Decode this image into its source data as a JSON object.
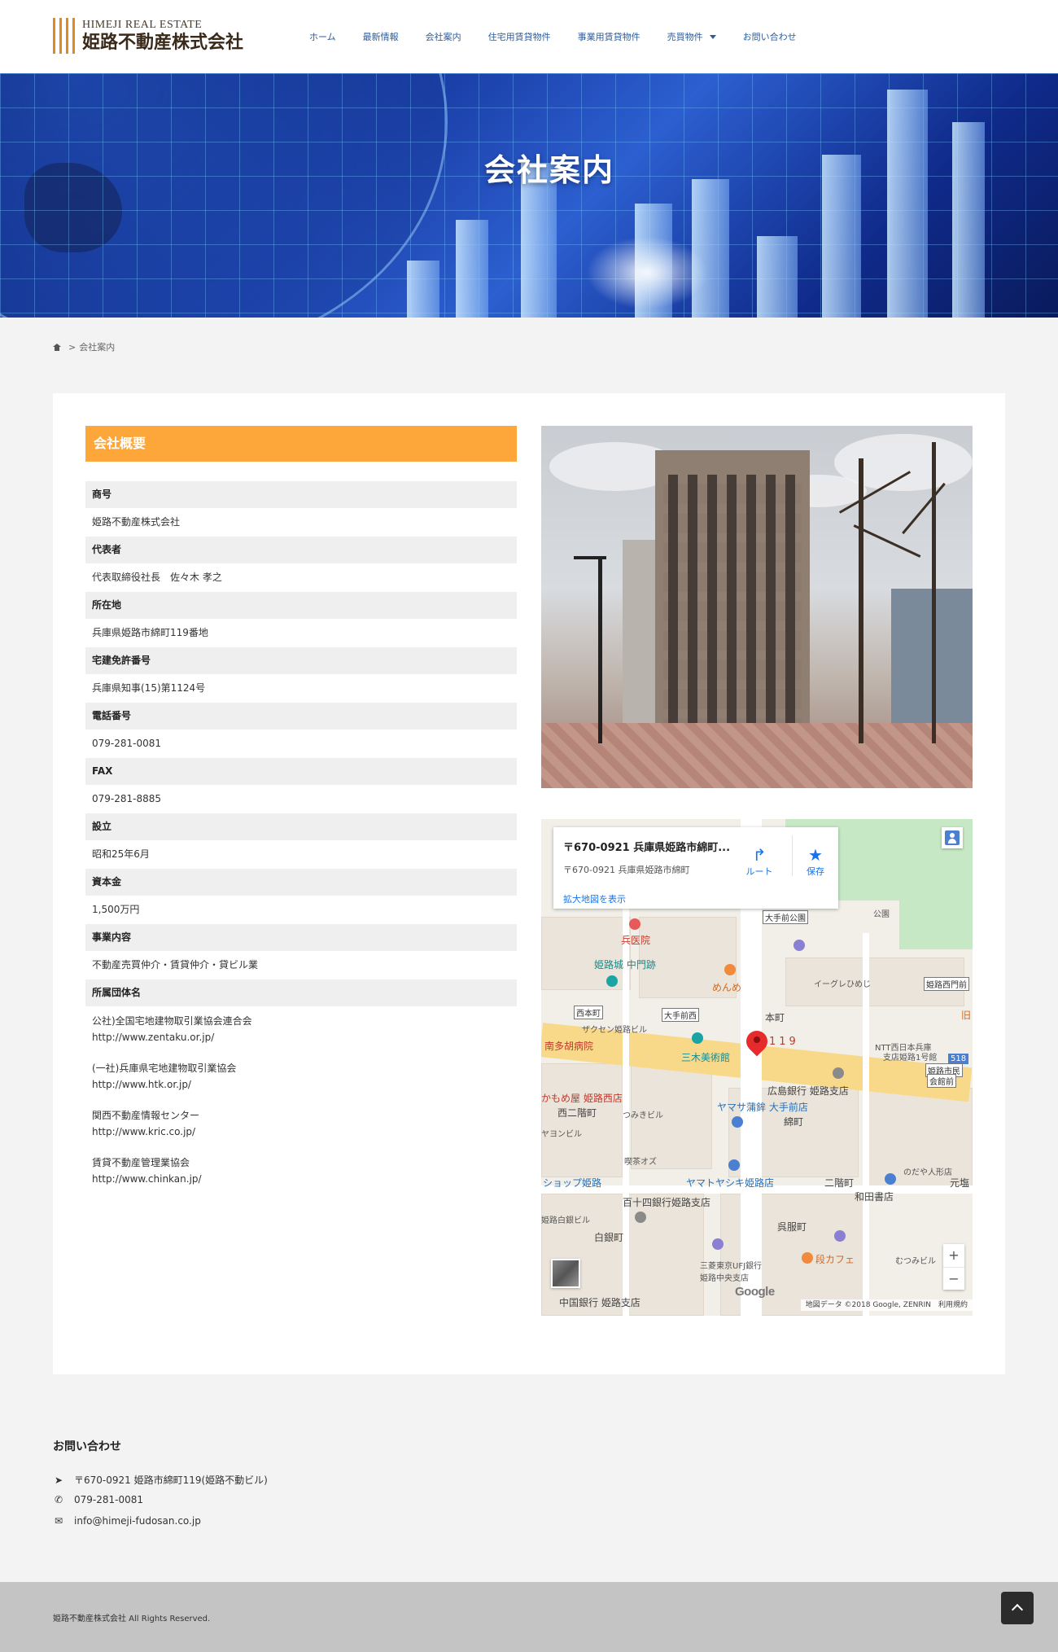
{
  "header": {
    "logo_en": "HIMEJI REAL ESTATE",
    "logo_ja": "姫路不動産株式会社",
    "nav": [
      {
        "label": "ホーム"
      },
      {
        "label": "最新情報"
      },
      {
        "label": "会社案内"
      },
      {
        "label": "住宅用賃貸物件"
      },
      {
        "label": "事業用賃貸物件"
      },
      {
        "label": "売買物件"
      },
      {
        "label": "お問い合わせ"
      }
    ]
  },
  "hero": {
    "title": "会社案内"
  },
  "breadcrumb": {
    "current": "会社案内",
    "separator": ">"
  },
  "company": {
    "heading": "会社概要",
    "rows": [
      {
        "label": "商号",
        "value": "姫路不動産株式会社"
      },
      {
        "label": "代表者",
        "value": "代表取締役社長　佐々木 孝之"
      },
      {
        "label": "所在地",
        "value": "兵庫県姫路市綿町119番地"
      },
      {
        "label": "宅建免許番号",
        "value": "兵庫県知事(15)第1124号"
      },
      {
        "label": "電話番号",
        "value": "079-281-0081"
      },
      {
        "label": "FAX",
        "value": "079-281-8885"
      },
      {
        "label": "設立",
        "value": "昭和25年6月"
      },
      {
        "label": "資本金",
        "value": "1,500万円"
      },
      {
        "label": "事業内容",
        "value": "不動産売買仲介・賃貸仲介・貸ビル業"
      }
    ],
    "org_label": "所属団体名",
    "orgs": [
      {
        "name": "公社)全国宅地建物取引業協会連合会",
        "url": "http://www.zentaku.or.jp/"
      },
      {
        "name": "(一社)兵庫県宅地建物取引業協会",
        "url": "http://www.htk.or.jp/"
      },
      {
        "name": "関西不動産情報センター",
        "url": "http://www.kric.co.jp/"
      },
      {
        "name": "賃貸不動産管理業協会",
        "url": "http://www.chinkan.jp/"
      }
    ]
  },
  "map": {
    "info_title": "〒670-0921 兵庫県姫路市綿町...",
    "info_address": "〒670-0921 兵庫県姫路市綿町",
    "route_label": "ルート",
    "save_label": "保存",
    "enlarge_label": "拡大地図を表示",
    "marker_label": "119",
    "google_label": "Google",
    "attribution": "地図データ ©2018 Google, ZENRIN　利用規約",
    "labels": {
      "park": "公園",
      "otemae_park": "大手前公園",
      "hyo_hospital": "兵医院",
      "himeji_gate": "姫路城 中門跡",
      "menme": "めんめ",
      "nishi_honmachi": "西本町",
      "otemae_mae": "大手前西",
      "zakusen": "ザクセン姫路ビル",
      "honmachi": "本町",
      "igureku": "イーグレひめじ",
      "himeji_nishimon": "姫路西門前",
      "ntt": "NTT西日本兵庫",
      "ntt2": "支店姫路1号館",
      "route518": "518",
      "minami_tako": "南多胡病院",
      "miki_museum": "三木美術館",
      "himeji_shimin": "姫路市民",
      "kaikan": "会館前",
      "hiroshima_bank": "広島銀行 姫路支店",
      "yamasa": "ヤマサ蒲鉾 大手前店",
      "wata_machi": "綿町",
      "nishi_nikaimachi": "西二階町",
      "tsumaki": "つみきビル",
      "moshiya": "かもめ屋 姫路西店",
      "yarayon": "ヤヨンビル",
      "yamato_yashiki": "ヤマトヤシキ姫路店",
      "nikaimachi": "二階町",
      "wada": "和田書店",
      "nodaya": "のだや人形店",
      "motoshiro": "元塩",
      "shop_himeji": "ショップ姫路",
      "hyakujushi": "百十四銀行姫路支店",
      "shiroganemachi": "白銀町",
      "gofukumachi": "呉服町",
      "dan_cafe": "段カフェ",
      "mitsubishi": "三菱東京UFJ銀行",
      "himeji_chuo": "姫路中央支店",
      "chugoku_bank": "中国銀行 姫路支店",
      "mutsumi": "むつみビル",
      "himeji_shiro_building": "姫路白銀ビル",
      "kasai": "喫茶オズ",
      "ichii": "旧"
    }
  },
  "footer": {
    "title": "お問い合わせ",
    "address": "〒670-0921 姫路市綿町119(姫路不動ビル)",
    "phone": "079-281-0081",
    "email": "info@himeji-fudosan.co.jp",
    "copyright": "姫路不動産株式会社 All Rights Reserved."
  },
  "colors": {
    "accent": "#fda73b",
    "nav_text": "#2b5d9e",
    "hero_base": "#1b3fa8",
    "footer_bar": "#c4c4c4"
  },
  "icons": [
    "home-icon",
    "location-arrow-icon",
    "phone-icon",
    "envelope-icon",
    "chevron-up-icon",
    "route-icon",
    "star-icon",
    "pegman-icon",
    "map-marker-icon"
  ]
}
